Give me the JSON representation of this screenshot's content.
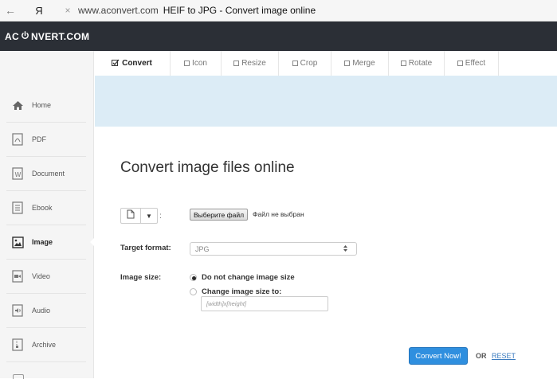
{
  "browser": {
    "back_icon": "←",
    "ya_logo": "Я",
    "close_icon": "×",
    "url": "www.aconvert.com",
    "title": "HEIF to JPG - Convert image online"
  },
  "site": {
    "logo_left": "AC",
    "logo_right": "NVERT.COM"
  },
  "tabs": [
    {
      "label": "Convert",
      "active": true
    },
    {
      "label": "Icon",
      "active": false
    },
    {
      "label": "Resize",
      "active": false
    },
    {
      "label": "Crop",
      "active": false
    },
    {
      "label": "Merge",
      "active": false
    },
    {
      "label": "Rotate",
      "active": false
    },
    {
      "label": "Effect",
      "active": false
    }
  ],
  "sidebar": {
    "items": [
      {
        "label": "Home",
        "icon": "home-icon"
      },
      {
        "label": "PDF",
        "icon": "pdf-icon"
      },
      {
        "label": "Document",
        "icon": "document-icon"
      },
      {
        "label": "Ebook",
        "icon": "ebook-icon"
      },
      {
        "label": "Image",
        "icon": "image-icon",
        "active": true
      },
      {
        "label": "Video",
        "icon": "video-icon"
      },
      {
        "label": "Audio",
        "icon": "audio-icon"
      },
      {
        "label": "Archive",
        "icon": "archive-icon"
      }
    ]
  },
  "main": {
    "title": "Convert image files online",
    "choose_file": "Выберите файл",
    "no_file": "Файл не выбран",
    "colon": ":",
    "target_format_label": "Target format:",
    "target_format_value": "JPG",
    "image_size_label": "Image size:",
    "size_options": [
      {
        "label": "Do not change image size",
        "checked": true
      },
      {
        "label": "Change image size to:",
        "checked": false
      }
    ],
    "size_placeholder": "[width]x[height]",
    "convert_button": "Convert Now!",
    "or": "OR",
    "reset": "RESET"
  },
  "colors": {
    "header_bg": "#2b2f36",
    "banner_bg": "#dcecf6",
    "convert_button_bg": "#2f8fdf",
    "link": "#3b7bbf"
  }
}
